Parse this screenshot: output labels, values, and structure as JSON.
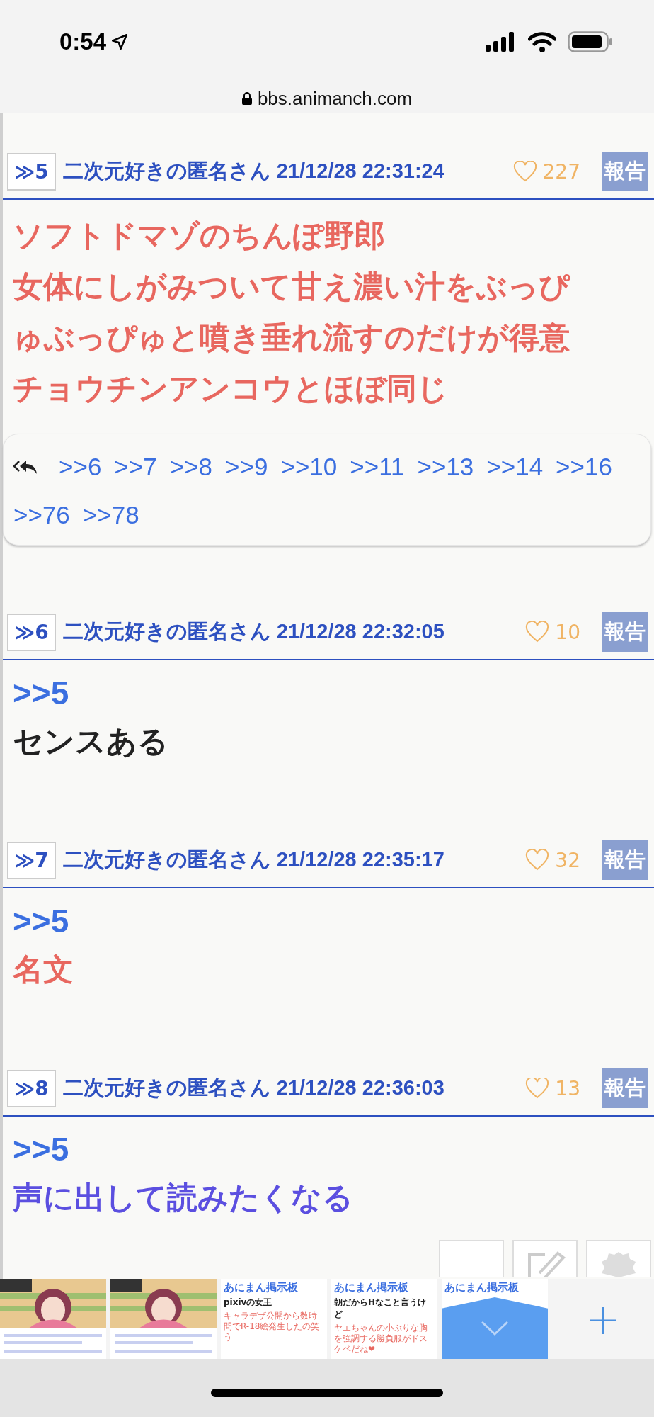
{
  "status_bar": {
    "time": "0:54"
  },
  "address_bar": {
    "url": "bbs.animanch.com"
  },
  "posts": [
    {
      "number": "≫5",
      "author": "二次元好きの匿名さん",
      "date": "21/12/28 22:31:24",
      "likes": "227",
      "report": "報告",
      "color": "#e8675f",
      "lines": [
        "ソフトドマゾのちんぽ野郎",
        "女体にしがみついて甘え濃い汁をぶっぴゅぶっぴゅと噴き垂れ流すのだけが得意",
        "チョウチンアンコウとほぼ同じ"
      ],
      "replies": [
        ">>6",
        ">>7",
        ">>8",
        ">>9",
        ">>10",
        ">>11",
        ">>13",
        ">>14",
        ">>16",
        ">>76",
        ">>78"
      ]
    },
    {
      "number": "≫6",
      "author": "二次元好きの匿名さん",
      "date": "21/12/28 22:32:05",
      "likes": "10",
      "report": "報告",
      "color": "#222222",
      "quote": ">>5",
      "lines": [
        "センスある"
      ]
    },
    {
      "number": "≫7",
      "author": "二次元好きの匿名さん",
      "date": "21/12/28 22:35:17",
      "likes": "32",
      "report": "報告",
      "color": "#e8675f",
      "quote": ">>5",
      "lines": [
        "名文"
      ]
    },
    {
      "number": "≫8",
      "author": "二次元好きの匿名さん",
      "date": "21/12/28 22:36:03",
      "likes": "13",
      "report": "報告",
      "color": "#5b4fe0",
      "quote": ">>5",
      "lines": [
        "声に出して読みたくなる"
      ]
    }
  ],
  "tabs": [
    {
      "kind": "picture"
    },
    {
      "kind": "picture"
    },
    {
      "kind": "page",
      "title": "あにまん掲示板",
      "thread": "pixivの女王",
      "body": "キャラデザ公開から数時間でR-18絵発生したの笑う"
    },
    {
      "kind": "page",
      "title": "あにまん掲示板",
      "thread": "朝だからHなこと言うけど",
      "body": "ヤエちゃんの小ぶりな胸を強調する勝負服がドスケベだね❤"
    },
    {
      "kind": "covered",
      "title": "あにまん掲示板"
    }
  ],
  "new_tab": {
    "label": "+"
  }
}
